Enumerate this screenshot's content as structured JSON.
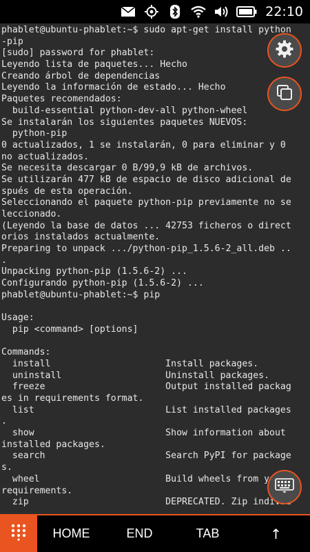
{
  "status_bar": {
    "time": "22:10",
    "icons": [
      "mail-icon",
      "location-icon",
      "bluetooth-icon",
      "wifi-icon",
      "volume-icon",
      "battery-icon"
    ]
  },
  "terminal": {
    "lines": [
      "phablet@ubuntu-phablet:~$ sudo apt-get install python",
      "-pip",
      "[sudo] password for phablet:",
      "Leyendo lista de paquetes... Hecho",
      "Creando árbol de dependencias",
      "Leyendo la información de estado... Hecho",
      "Paquetes recomendados:",
      "  build-essential python-dev-all python-wheel",
      "Se instalarán los siguientes paquetes NUEVOS:",
      "  python-pip",
      "0 actualizados, 1 se instalarán, 0 para eliminar y 0",
      "no actualizados.",
      "Se necesita descargar 0 B/99,9 kB de archivos.",
      "Se utilizarán 477 kB de espacio de disco adicional de",
      "spués de esta operación.",
      "Seleccionando el paquete python-pip previamente no se",
      "leccionado.",
      "(Leyendo la base de datos ... 42753 ficheros o direct",
      "orios instalados actualmente.",
      "Preparing to unpack .../python-pip_1.5.6-2_all.deb ..",
      ".",
      "Unpacking python-pip (1.5.6-2) ...",
      "Configurando python-pip (1.5.6-2) ...",
      "phablet@ubuntu-phablet:~$ pip",
      "",
      "Usage:",
      "  pip <command> [options]",
      "",
      "Commands:",
      "  install                     Install packages.",
      "  uninstall                   Uninstall packages.",
      "  freeze                      Output installed packag",
      "es in requirements format.",
      "  list                        List installed packages",
      ".",
      "  show                        Show information about",
      "installed packages.",
      "  search                      Search PyPI for package",
      "s.",
      "  wheel                       Build wheels from your",
      "requirements.",
      "  zip                         DEPRECATED. Zip individ"
    ]
  },
  "bottom_bar": {
    "keys": [
      "HOME",
      "END",
      "TAB",
      "↑"
    ]
  },
  "colors": {
    "accent": "#e95420",
    "terminal_bg": "#2c2c2c",
    "terminal_fg": "#e8e8e8"
  }
}
